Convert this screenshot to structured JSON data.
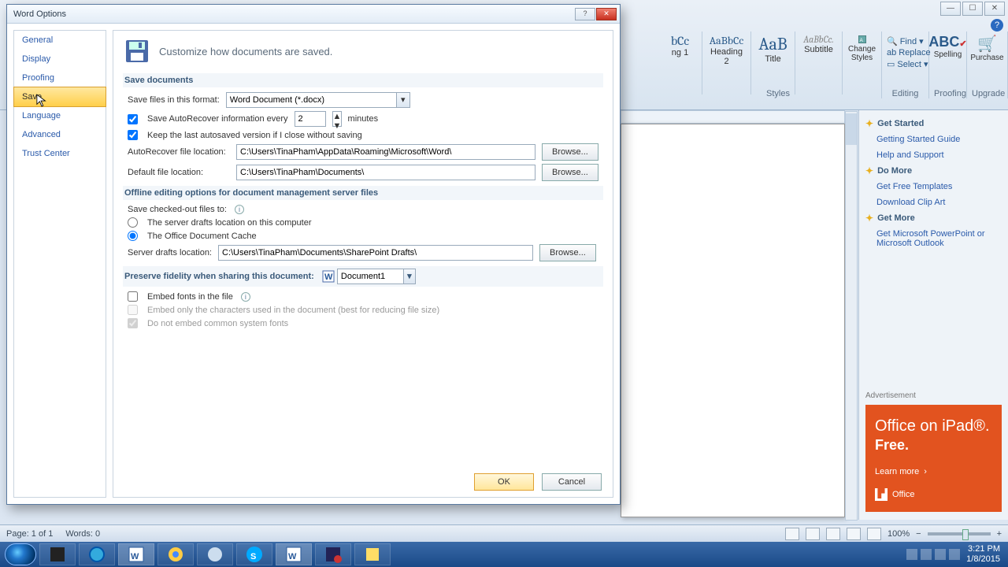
{
  "dialog": {
    "title": "Word Options",
    "header_text": "Customize how documents are saved.",
    "nav": [
      "General",
      "Display",
      "Proofing",
      "Save",
      "Language",
      "Advanced",
      "Trust Center"
    ],
    "nav_selected": 3,
    "section1": "Save documents",
    "save_format_label": "Save files in this format:",
    "save_format_value": "Word Document (*.docx)",
    "autorecover_label": "Save AutoRecover information every",
    "autorecover_value": "2",
    "autorecover_unit": "minutes",
    "keep_last_label": "Keep the last autosaved version if I close without saving",
    "autorecover_loc_label": "AutoRecover file location:",
    "autorecover_loc_value": "C:\\Users\\TinaPham\\AppData\\Roaming\\Microsoft\\Word\\",
    "default_loc_label": "Default file location:",
    "default_loc_value": "C:\\Users\\TinaPham\\Documents\\",
    "browse": "Browse...",
    "section2": "Offline editing options for document management server files",
    "checkedout_label": "Save checked-out files to:",
    "opt_server_drafts": "The server drafts location on this computer",
    "opt_doc_cache": "The Office Document Cache",
    "server_drafts_label": "Server drafts location:",
    "server_drafts_value": "C:\\Users\\TinaPham\\Documents\\SharePoint Drafts\\",
    "section3": "Preserve fidelity when sharing this document:",
    "fidelity_doc": "Document1",
    "embed_fonts": "Embed fonts in the file",
    "embed_chars_only": "Embed only the characters used in the document (best for reducing file size)",
    "embed_no_system": "Do not embed common system fonts",
    "ok": "OK",
    "cancel": "Cancel"
  },
  "ribbon": {
    "styles": [
      {
        "sample": "bCc",
        "label": "ng 1"
      },
      {
        "sample": "AaBbCc",
        "label": "Heading 2"
      },
      {
        "sample": "AaB",
        "label": "Title"
      },
      {
        "sample": "AaBbCc.",
        "label": "Subtitle"
      }
    ],
    "change_styles": "Change Styles",
    "find": "Find",
    "replace": "Replace",
    "select": "Select",
    "spelling": "Spelling",
    "purchase": "Purchase",
    "groups": [
      "Styles",
      "Editing",
      "Proofing",
      "Upgrade"
    ]
  },
  "taskpane": {
    "h1": "Get Started",
    "l1a": "Getting Started Guide",
    "l1b": "Help and Support",
    "h2": "Do More",
    "l2a": "Get Free Templates",
    "l2b": "Download Clip Art",
    "h3": "Get More",
    "l3a": "Get Microsoft PowerPoint or Microsoft Outlook",
    "ad_label": "Advertisement",
    "ad_title1": "Office on iPad®.",
    "ad_title2": "Free.",
    "ad_learn": "Learn more",
    "ad_brand": "Office"
  },
  "statusbar": {
    "page": "Page: 1 of 1",
    "words": "Words: 0",
    "zoom": "100%"
  },
  "tray": {
    "time": "3:21 PM",
    "date": "1/8/2015"
  }
}
